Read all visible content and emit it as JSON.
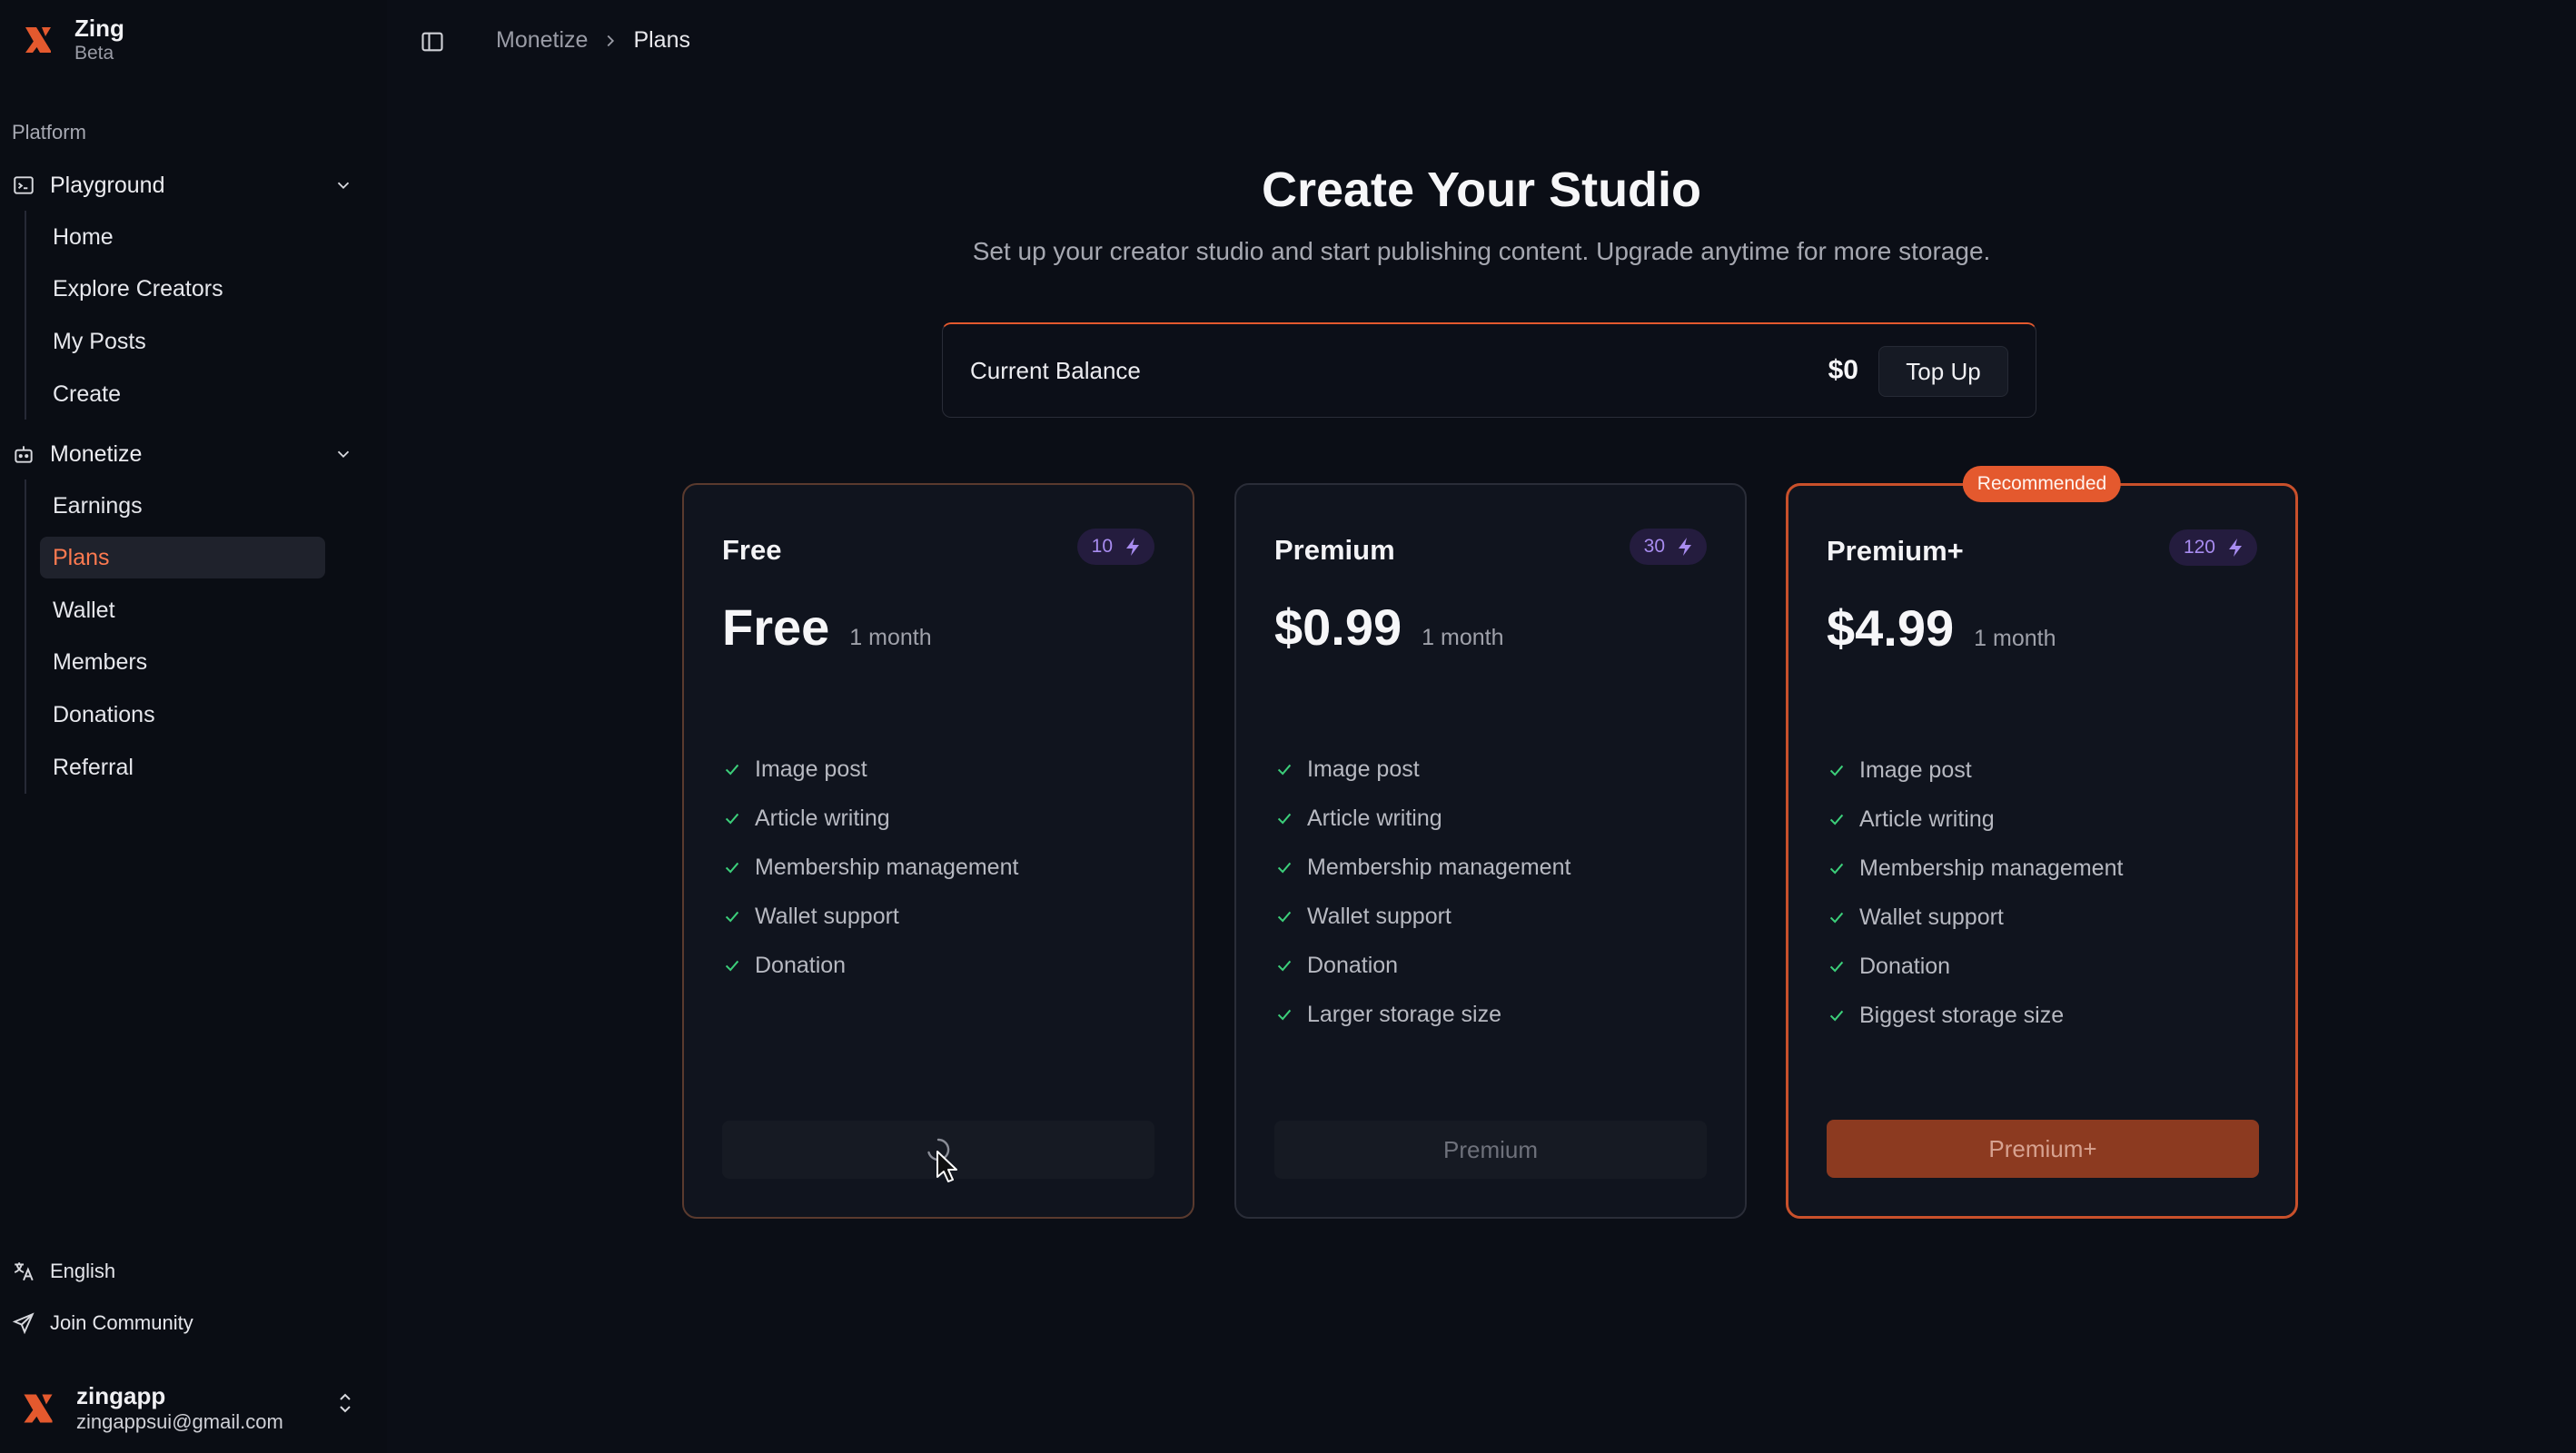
{
  "app": {
    "name": "Zing",
    "badge": "Beta"
  },
  "sidebar": {
    "group_label": "Platform",
    "sections": [
      {
        "label": "Playground",
        "icon": "terminal-icon",
        "items": [
          "Home",
          "Explore Creators",
          "My Posts",
          "Create"
        ]
      },
      {
        "label": "Monetize",
        "icon": "robot-icon",
        "items": [
          "Earnings",
          "Plans",
          "Wallet",
          "Members",
          "Donations",
          "Referral"
        ]
      }
    ],
    "active_item": "Plans",
    "footer": {
      "language": "English",
      "community": "Join Community"
    },
    "user": {
      "name": "zingapp",
      "email": "zingappsui@gmail.com"
    }
  },
  "breadcrumb": {
    "parent": "Monetize",
    "current": "Plans"
  },
  "main": {
    "title": "Create Your Studio",
    "subtitle": "Set up your creator studio and start publishing content. Upgrade anytime for more storage.",
    "balance": {
      "label": "Current Balance",
      "value": "$0",
      "button": "Top Up"
    },
    "plans": [
      {
        "name": "Free",
        "credits": "10",
        "price": "Free",
        "period": "1 month",
        "features": [
          "Image post",
          "Article writing",
          "Membership management",
          "Wallet support",
          "Donation"
        ],
        "button": "",
        "button_state": "loading"
      },
      {
        "name": "Premium",
        "credits": "30",
        "price": "$0.99",
        "period": "1 month",
        "features": [
          "Image post",
          "Article writing",
          "Membership management",
          "Wallet support",
          "Donation",
          "Larger storage size"
        ],
        "button": "Premium",
        "button_state": "disabled"
      },
      {
        "name": "Premium+",
        "credits": "120",
        "price": "$4.99",
        "period": "1 month",
        "features": [
          "Image post",
          "Article writing",
          "Membership management",
          "Wallet support",
          "Donation",
          "Biggest storage size"
        ],
        "button": "Premium+",
        "badge": "Recommended",
        "button_state": "enabled"
      }
    ]
  },
  "colors": {
    "accent": "#e4592e",
    "check": "#3ccf7a",
    "credit": "#a88cf0",
    "background": "#0b0e16"
  }
}
